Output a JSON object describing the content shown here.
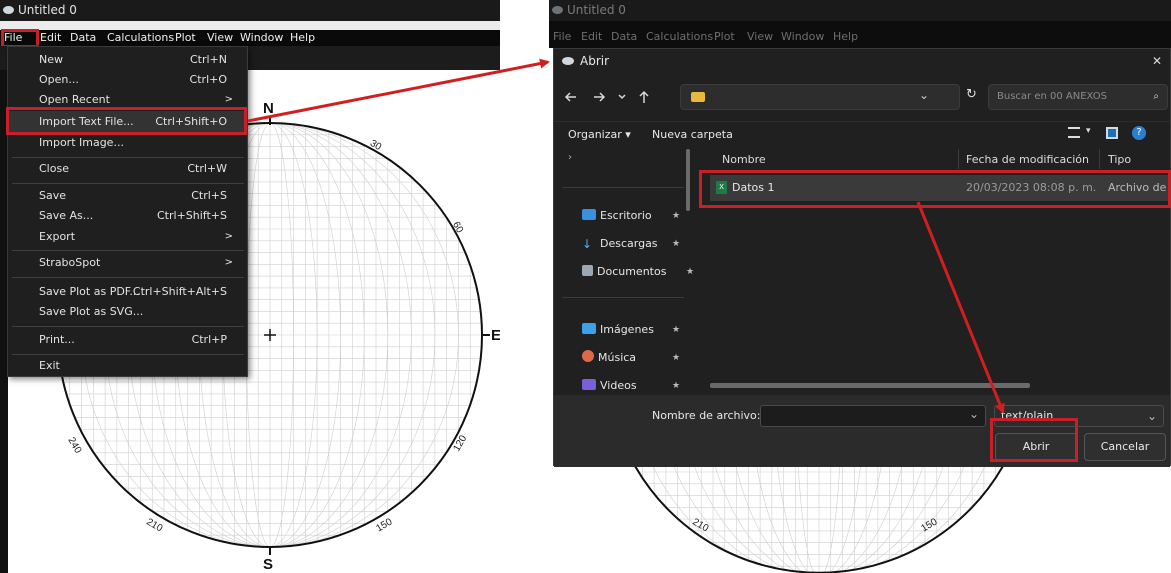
{
  "left_window": {
    "title": "Untitled 0",
    "menu": [
      "File",
      "Edit",
      "Data",
      "Calculations",
      "Plot",
      "View",
      "Window",
      "Help"
    ],
    "file_menu": [
      {
        "label": "New",
        "shortcut": "Ctrl+N"
      },
      {
        "label": "Open...",
        "shortcut": "Ctrl+O"
      },
      {
        "label": "Open Recent",
        "shortcut": "",
        "submenu": ">"
      },
      {
        "label": "Import Text File...",
        "shortcut": "Ctrl+Shift+O"
      },
      {
        "label": "Import Image...",
        "shortcut": ""
      },
      {
        "label": "Close",
        "shortcut": "Ctrl+W"
      },
      {
        "label": "Save",
        "shortcut": "Ctrl+S"
      },
      {
        "label": "Save As...",
        "shortcut": "Ctrl+Shift+S"
      },
      {
        "label": "Export",
        "shortcut": "",
        "submenu": ">"
      },
      {
        "label": "StraboSpot",
        "shortcut": "",
        "submenu": ">"
      },
      {
        "label": "Save Plot as PDF...",
        "shortcut": "Ctrl+Shift+Alt+S"
      },
      {
        "label": "Save Plot as SVG...",
        "shortcut": ""
      },
      {
        "label": "Print...",
        "shortcut": "Ctrl+P"
      },
      {
        "label": "Exit",
        "shortcut": ""
      }
    ],
    "stereonet": {
      "north": "N",
      "east": "E",
      "south": "S",
      "center": "+",
      "ticks": [
        "30",
        "60",
        "120",
        "150",
        "210",
        "240"
      ]
    }
  },
  "right_window": {
    "title": "Untitled 0",
    "menu": [
      "File",
      "Edit",
      "Data",
      "Calculations",
      "Plot",
      "View",
      "Window",
      "Help"
    ],
    "dialog": {
      "title": "Abrir",
      "close_glyph": "✕",
      "search_placeholder": "Buscar en 00 ANEXOS",
      "organize": "Organizar ▾",
      "new_folder": "Nueva carpeta",
      "columns": [
        "Nombre",
        "Fecha de modificación",
        "Tipo"
      ],
      "nav": [
        "Escritorio",
        "Descargas",
        "Documentos",
        "Imágenes",
        "Música",
        "Videos"
      ],
      "file": {
        "name": "Datos 1",
        "date": "20/03/2023 08:08 p. m.",
        "type": "Archivo de v"
      },
      "filename_label": "Nombre de archivo:",
      "filter": "text/plain",
      "open_button": "Abrir",
      "cancel_button": "Cancelar"
    },
    "stereonet_ticks": [
      "210",
      "150"
    ]
  },
  "colors": {
    "highlight": "#c8202a",
    "arrow": "#d11f1f"
  }
}
